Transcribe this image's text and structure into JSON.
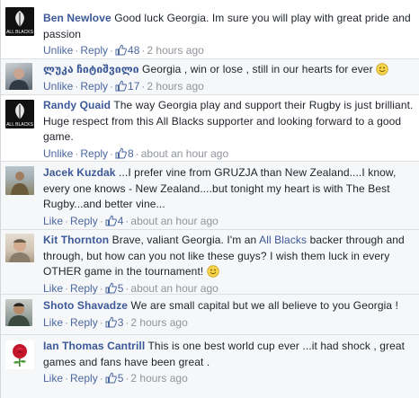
{
  "comments": [
    {
      "author": "Ben Newlove",
      "text": "Good luck Georgia. Im sure you will play with great pride and passion",
      "unlike": "Unlike",
      "reply": "Reply",
      "likes": "48",
      "time": "2 hours ago",
      "avatar_icon": "fern-logo-icon",
      "avatar_text": "ALL BLACKS"
    },
    {
      "author": "ლუკა ჩიტიშვილი",
      "text": "Georgia , win or lose , still in our hearts for ever",
      "emoji": "smiley-emoji",
      "unlike": "Unlike",
      "reply": "Reply",
      "likes": "17",
      "time": "2 hours ago"
    },
    {
      "author": "Randy Quaid",
      "text": "The way Georgia play and support their Rugby is just brilliant. Huge respect from this All Blacks supporter and looking forward to a good game.",
      "unlike": "Unlike",
      "reply": "Reply",
      "likes": "8",
      "time": "about an hour ago",
      "avatar_icon": "fern-logo-icon",
      "avatar_text": "ALL BLACKS"
    },
    {
      "author": "Jacek Kuzdak",
      "text": "...I prefer vine from GRUZJA than New Zealand....I know, every one knows - New Zealand....but tonight my heart is with The Best Rugby...and better vine...",
      "like": "Like",
      "reply": "Reply",
      "likes": "4",
      "time": "about an hour ago"
    },
    {
      "author": "Kit Thornton",
      "text_before": "Brave, valiant Georgia. I'm an",
      "link": "All Blacks",
      "text_after": "backer through and through, but how can you not like these guys? I wish them luck in every OTHER game in the tournament!",
      "emoji": "smiley-emoji",
      "like": "Like",
      "reply": "Reply",
      "likes": "5",
      "time": "about an hour ago"
    },
    {
      "author": "Shoto Shavadze",
      "text": "We are small capital but we all believe to you Georgia !",
      "like": "Like",
      "reply": "Reply",
      "likes": "3",
      "time": "2 hours ago"
    },
    {
      "author": "Ian Thomas Cantrill",
      "text": "This is one best world cup ever ...it had shock , great games and fans have been great .",
      "like": "Like",
      "reply": "Reply",
      "likes": "5",
      "time": "2 hours ago",
      "avatar_icon": "rose-icon"
    }
  ],
  "colors": {
    "link": "#3b5998",
    "meta": "#90949c",
    "alt_background": "#f6f7f9"
  }
}
